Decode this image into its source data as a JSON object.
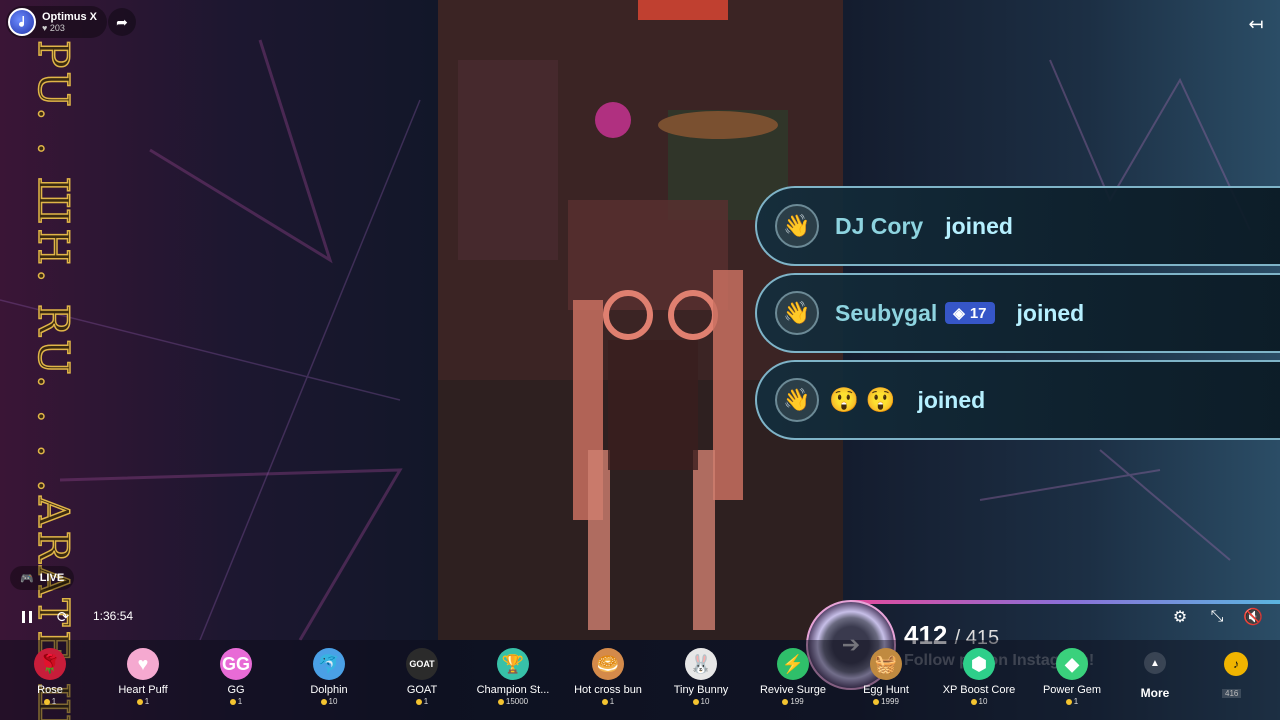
{
  "host": {
    "name": "Optimus X",
    "viewers": "203"
  },
  "vertical_text": "PU. . ШН. RU. . . .ARATE ШН. F. R",
  "joins": [
    {
      "name": "DJ Cory",
      "badge": "",
      "emojis": "",
      "action": "joined"
    },
    {
      "name": "Seubygal",
      "badge": "17",
      "emojis": "",
      "action": "joined"
    },
    {
      "name": "",
      "badge": "",
      "emojis": "😲 😲",
      "action": "joined"
    }
  ],
  "live": {
    "label": "LIVE"
  },
  "playback": {
    "time": "1:36:54"
  },
  "counter": {
    "current": "412",
    "total": "/ 415",
    "marquee": "Follow  pfp on Instagram!"
  },
  "gifts": [
    {
      "name": "Rose",
      "price": "1",
      "icon": "rose-icon",
      "glyph": "🌹",
      "color": "#c81d3a"
    },
    {
      "name": "Heart Puff",
      "price": "1",
      "icon": "heart-puff-icon",
      "glyph": "♥",
      "color": "#f5a9d0"
    },
    {
      "name": "GG",
      "price": "1",
      "icon": "gg-icon",
      "glyph": "GG",
      "color": "#e86bd6"
    },
    {
      "name": "Dolphin",
      "price": "10",
      "icon": "dolphin-icon",
      "glyph": "🐬",
      "color": "#4aa0e6"
    },
    {
      "name": "GOAT",
      "price": "1",
      "icon": "goat-icon",
      "glyph": "GOAT",
      "color": "#2b2b2b"
    },
    {
      "name": "Champion St...",
      "price": "15000",
      "icon": "champion-icon",
      "glyph": "🏆",
      "color": "#37c1a8"
    },
    {
      "name": "Hot cross bun",
      "price": "1",
      "icon": "bun-icon",
      "glyph": "🥯",
      "color": "#d48a4a"
    },
    {
      "name": "Tiny Bunny",
      "price": "10",
      "icon": "bunny-icon",
      "glyph": "🐰",
      "color": "#e7e7e7"
    },
    {
      "name": "Revive Surge",
      "price": "199",
      "icon": "revive-icon",
      "glyph": "⚡",
      "color": "#2fbf6a"
    },
    {
      "name": "Egg Hunt",
      "price": "1999",
      "icon": "egg-basket-icon",
      "glyph": "🧺",
      "color": "#c08a40"
    },
    {
      "name": "XP Boost Core",
      "price": "10",
      "icon": "xp-boost-icon",
      "glyph": "⬢",
      "color": "#2ecf8a"
    },
    {
      "name": "Power Gem",
      "price": "1",
      "icon": "power-gem-icon",
      "glyph": "◆",
      "color": "#3ad17c"
    }
  ],
  "more": {
    "label": "More"
  },
  "tag": {
    "label": "416"
  }
}
